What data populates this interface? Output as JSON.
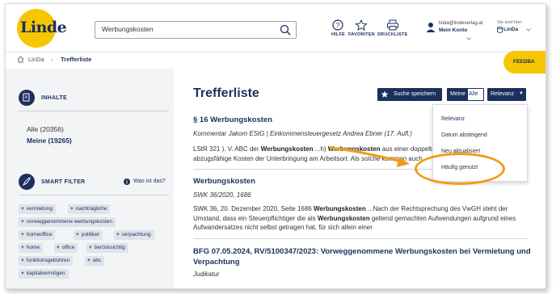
{
  "header": {
    "logo_text": "Linde",
    "search_value": "Werbungskosten",
    "buttons": [
      {
        "label": "HILFE",
        "icon": "help-icon"
      },
      {
        "label": "FAVORITEN",
        "icon": "star-icon"
      },
      {
        "label": "DRUCKLISTE",
        "icon": "printer-icon"
      }
    ],
    "account": {
      "email": "linda@lindeverlag.at",
      "name": "Mein Konto",
      "icon": "user-icon"
    },
    "location": {
      "caption": "Sie sind hier:",
      "value": "LinDa",
      "icon": "database-icon"
    }
  },
  "breadcrumb": {
    "home": "LinDa",
    "current": "Trefferliste"
  },
  "feedback_label": "FEEDBA",
  "sidebar": {
    "contents_title": "INHALTE",
    "counts": {
      "all": "Alle (20356)",
      "mine": "Meine (19265)"
    },
    "filter_title": "SMART FILTER",
    "filter_help": "Was ist das?",
    "tags": [
      "vermietung",
      "nachträgliche",
      "vorweggenommene werbungskosten",
      "homeoffice",
      "politiker",
      "verpachtung",
      "home",
      "office",
      "berücksichtig",
      "funktionsgebühren",
      "abc",
      "kapitalvermögen"
    ]
  },
  "main": {
    "title": "Trefferliste",
    "save_search": "Suche speichern",
    "toggle": {
      "mine": "Meine",
      "all": "Alle"
    },
    "sort_label": "Relevanz",
    "sort_options": [
      "Relevanz",
      "Datum absteigend",
      "Neu aktualisiert",
      "Häufig genutzt"
    ],
    "results": [
      {
        "title": "§ 16 Werbungskosten",
        "meta": "Kommentar Jakom EStG | Einkommensteuergesetz Andrea Ebner (17. Aufl.)",
        "snippet": [
          {
            "t": "LStR 321 ). V. ABC der "
          },
          {
            "t": "Werbungskosten",
            "b": true
          },
          {
            "t": " ...h) "
          },
          {
            "t": "Werbungskosten",
            "b": true
          },
          {
            "t": "  aus einer doppelten Haushaltsführung ... sind abzugsfähige Kosten der Unterbringung am Arbeitsort. Als solche kommen auch"
          }
        ]
      },
      {
        "title": "Werbungskosten",
        "meta": "SWK 36/2020, 1686",
        "snippet": [
          {
            "t": "SWK 36, 20. Dezember 2020, Seite 1686 "
          },
          {
            "t": "Werbungskosten",
            "b": true
          },
          {
            "t": " ...Nach der Rechtsprechung des VwGH steht der Umstand, dass ein Steuerpflichtiger die als "
          },
          {
            "t": "Werbungskosten",
            "b": true
          },
          {
            "t": "  geltend gemachten Aufwendungen aufgrund eines Aufwandersatzes nicht selbst getragen hat, für sich allein einer"
          }
        ]
      },
      {
        "title": "BFG 07.05.2024, RV/5100347/2023: Vorweggenommene Werbungskosten bei Vermietung und Verpachtung",
        "meta": "Judikatur"
      }
    ]
  },
  "colors": {
    "brand_navy": "#1c2f5e",
    "brand_yellow": "#f6c700",
    "annotation_orange": "#f39a18"
  }
}
